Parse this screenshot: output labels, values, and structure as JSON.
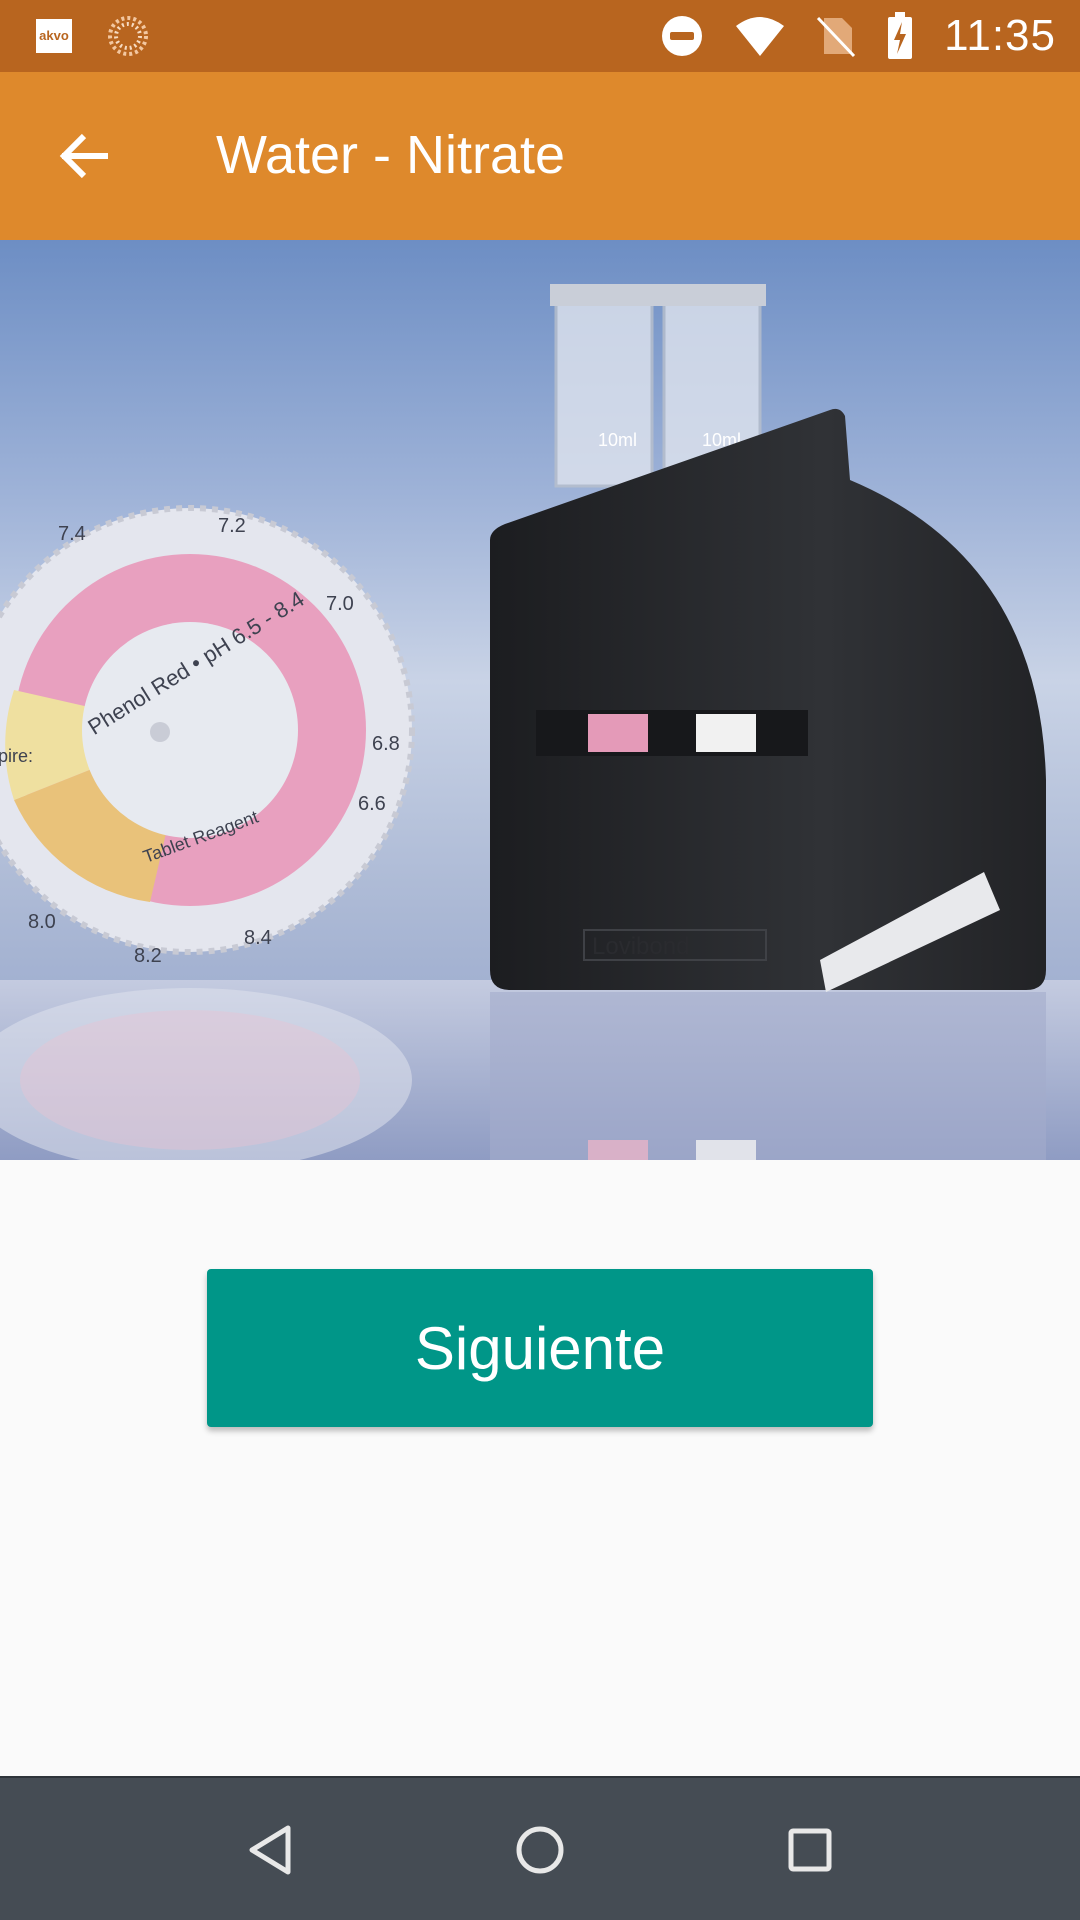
{
  "status_bar": {
    "app_icon_label": "akvo",
    "time": "11:35",
    "icons": [
      "akvo-app-icon",
      "loading-spinner-icon",
      "do-not-disturb-icon",
      "wifi-icon",
      "no-sim-icon",
      "battery-charging-icon"
    ]
  },
  "app_bar": {
    "title": "Water - Nitrate",
    "back_icon": "arrow-back-icon"
  },
  "hero_image": {
    "description_icon": "comparator-kit-photo",
    "dial_labels": {
      "center_top": "Phenol Red • pH 6.5 - 8.4",
      "center_bottom": "Tablet Reagent",
      "left": "pire:",
      "ticks": [
        "7.4",
        "7.2",
        "7.0",
        "6.8",
        "6.6",
        "8.4",
        "8.2",
        "8.0"
      ]
    },
    "tube_labels": [
      "10ml",
      "10ml"
    ],
    "brand": "Lovibond"
  },
  "main": {
    "next_button_label": "Siguiente"
  },
  "nav_bar": {
    "icons": [
      "back-triangle-icon",
      "home-circle-icon",
      "recents-square-icon"
    ]
  },
  "colors": {
    "status_bar": "#b8651f",
    "app_bar": "#de892c",
    "primary_button": "#009688",
    "nav_bar": "#454c54"
  }
}
